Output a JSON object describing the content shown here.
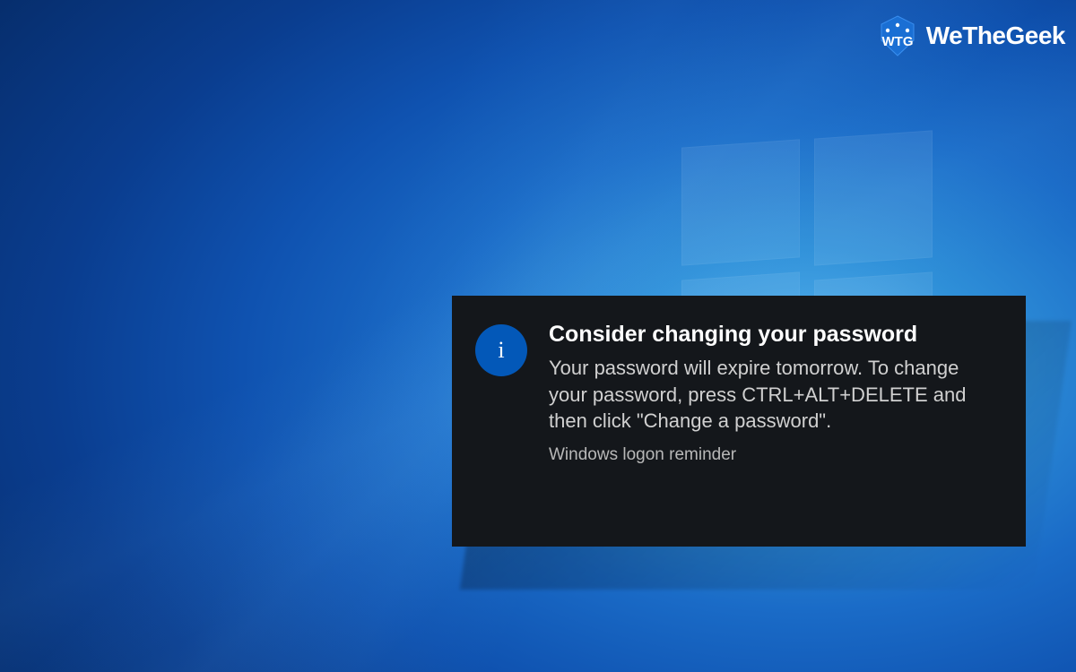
{
  "watermark": {
    "brand_name": "WeTheGeek",
    "logo_text": "WTG"
  },
  "notification": {
    "icon_name": "info-icon",
    "icon_glyph": "i",
    "title": "Consider changing your password",
    "body": "Your password will expire tomorrow. To change your password, press CTRL+ALT+DELETE and then click \"Change a password\".",
    "source": "Windows logon reminder"
  },
  "colors": {
    "notification_bg": "#14171b",
    "info_icon_bg": "#0358b8",
    "desktop_primary": "#0f52b0"
  }
}
